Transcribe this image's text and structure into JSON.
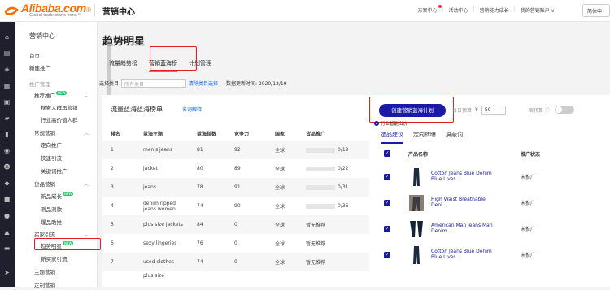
{
  "header": {
    "logo": "Alibaba.com",
    "logo_tm": "®",
    "logo_sub": "Global trade starts here.™",
    "title": "营销中心",
    "nav": [
      "方案中心",
      "活动中心",
      "营销能力成长",
      "我的营销账户 ∨"
    ],
    "lang": "简体中"
  },
  "sidebar": {
    "title": "营销中心",
    "items": [
      {
        "label": "首页"
      },
      {
        "label": "新建推广"
      },
      {
        "label": "推广管理"
      },
      {
        "label": "推荐推广"
      },
      {
        "label": "搜索人群再营销"
      },
      {
        "label": "行业高价值人群"
      },
      {
        "label": "常规营销"
      },
      {
        "label": "定向推广"
      },
      {
        "label": "快速引流"
      },
      {
        "label": "关键词推广"
      },
      {
        "label": "货品营销"
      },
      {
        "label": "新品成长"
      },
      {
        "label": "测品测款"
      },
      {
        "label": "爆品助推"
      },
      {
        "label": "买家引流"
      },
      {
        "label": "趋势明星"
      },
      {
        "label": "新买家引流"
      },
      {
        "label": "主题营销"
      },
      {
        "label": "定制营销"
      }
    ],
    "new_tag": "NEW"
  },
  "main": {
    "title": "趋势明星",
    "tabs": [
      {
        "label": "流量趋势榜"
      },
      {
        "label": "营销蓝海榜"
      },
      {
        "label": "计划管理"
      }
    ],
    "filter": {
      "label": "选择类目",
      "placeholder": "所有类目",
      "clear": "清除类目选择",
      "update": "数据更新时间: 2020/12/19"
    }
  },
  "left_panel": {
    "title": "流量蓝海蓝海榜单",
    "link": "名词解释",
    "columns": [
      "排名",
      "蓝海主题",
      "蓝海指数",
      "竞争力",
      "国家",
      "货品推广"
    ],
    "rows": [
      {
        "rank": "1",
        "theme": "men's jeans",
        "index": "81",
        "comp": "92",
        "country": "全球",
        "promo": "0/19"
      },
      {
        "rank": "2",
        "theme": "jacket",
        "index": "80",
        "comp": "89",
        "country": "全球",
        "promo": "0/22"
      },
      {
        "rank": "3",
        "theme": "jeans",
        "index": "78",
        "comp": "91",
        "country": "全球",
        "promo": "0/31"
      },
      {
        "rank": "4",
        "theme": "denim ripped jeans women",
        "index": "74",
        "comp": "90",
        "country": "全球",
        "promo": "0/36"
      },
      {
        "rank": "5",
        "theme": "plus size jackets",
        "index": "84",
        "comp": "0",
        "country": "全球",
        "promo": "暂无推荐"
      },
      {
        "rank": "6",
        "theme": "sexy lingeries",
        "index": "76",
        "comp": "0",
        "country": "全球",
        "promo": "暂无推荐"
      },
      {
        "rank": "7",
        "theme": "used clothes",
        "index": "74",
        "comp": "0",
        "country": "全球",
        "promo": "暂无推荐"
      },
      {
        "rank": "",
        "theme": "plus size",
        "index": "",
        "comp": "",
        "country": "",
        "promo": ""
      }
    ]
  },
  "right_panel": {
    "create_button": "创建营销蓝海计划",
    "budget_label": "每日预算",
    "currency": "¥",
    "budget_value": "50",
    "cycle_label": "周预算",
    "radio_label": "行业智能出价",
    "tabs": [
      {
        "label": "选品建议"
      },
      {
        "label": "定向转曝"
      },
      {
        "label": "屏蔽词"
      }
    ],
    "columns": [
      "产品名称",
      "推广状态"
    ],
    "products": [
      {
        "name": "Cotton Jeans Blue Denim Blue Lives...",
        "status": "未推广"
      },
      {
        "name": "High Waist Breathable Deni...",
        "status": "未推广"
      },
      {
        "name": "American Man Jeans Man Denim...",
        "status": "未推广"
      },
      {
        "name": "Cotton Jeans Blue Denim Blue Lives...",
        "status": "未推广"
      }
    ]
  },
  "icons": [
    "home-icon",
    "list-icon",
    "shield-icon",
    "grid-icon",
    "calendar-icon",
    "chat-icon",
    "chart-icon",
    "location-icon",
    "users-icon",
    "store-icon",
    "box-icon",
    "globe-icon",
    "bag-icon",
    "bank-icon",
    "send-icon"
  ]
}
